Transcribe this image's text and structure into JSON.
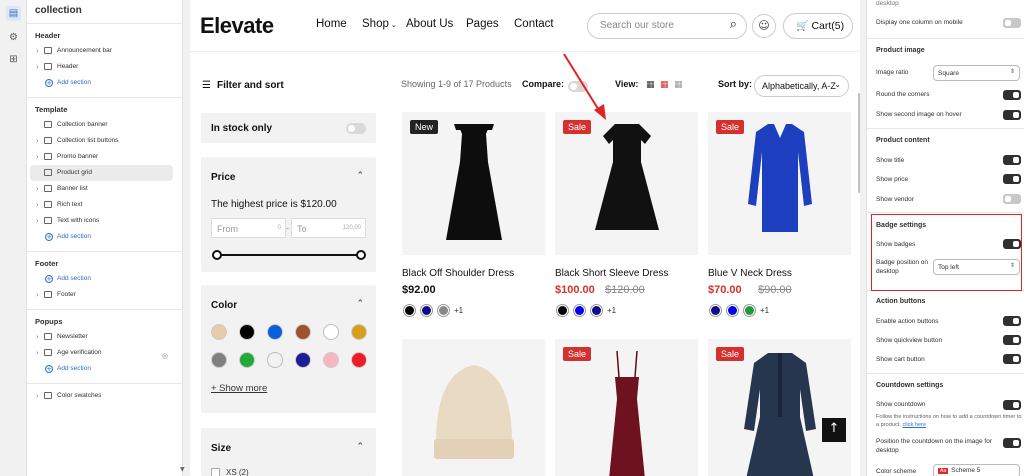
{
  "sidebar": {
    "title": "collection",
    "header_group": "Header",
    "announcement": "Announcement bar",
    "header": "Header",
    "add_section": "Add section",
    "template_group": "Template",
    "template_items": [
      "Collection banner",
      "Collection list buttons",
      "Promo banner",
      "Product grid",
      "Banner list",
      "Rich text",
      "Text with icons"
    ],
    "footer_group": "Footer",
    "footer": "Footer",
    "popups_group": "Popups",
    "newsletter": "Newsletter",
    "age": "Age verification",
    "color_swatches": "Color swatches"
  },
  "store": {
    "logo": "Elevate",
    "nav": [
      "Home",
      "Shop",
      "About Us",
      "Pages",
      "Contact"
    ],
    "search_placeholder": "Search our store",
    "cart": "Cart(5)"
  },
  "filters": {
    "title": "Filter and sort",
    "in_stock": "In stock only",
    "price_title": "Price",
    "price_text": "The highest price is $120.00",
    "from_label": "From",
    "from_val": "0",
    "to_label": "To",
    "to_val": "120.00",
    "currency_sep": "-",
    "color_title": "Color",
    "show_more": "+ Show more",
    "size_title": "Size",
    "size_first": "XS (2)",
    "colors": [
      "#e6ccaa",
      "#000000",
      "#0a60d8",
      "#a0522d",
      "#ffffff",
      "#d4a017",
      "#808080",
      "#1faa3a",
      "#f2f2f2",
      "#1e1e96",
      "#f7b6c2",
      "#ee1c24"
    ]
  },
  "toolbar": {
    "showing": "Showing 1-9 of 17 Products",
    "compare": "Compare:",
    "view": "View:",
    "sort_label": "Sort by:",
    "sort_value": "Alphabetically, A-Z"
  },
  "products": [
    {
      "name": "Black Off Shoulder Dress",
      "price": "$92.00",
      "compare": "",
      "badge": "New",
      "swatches": [
        "#000000",
        "#0b0b8c",
        "#888888"
      ],
      "more": "+1"
    },
    {
      "name": "Black Short Sleeve Dress",
      "price": "$100.00",
      "compare": "$120.00",
      "badge": "Sale",
      "swatches": [
        "#000000",
        "#0000ee",
        "#0b0b8c"
      ],
      "more": "+1"
    },
    {
      "name": "Blue V Neck Dress",
      "price": "$70.00",
      "compare": "$90.00",
      "badge": "Sale",
      "swatches": [
        "#0b0b8c",
        "#0000ee",
        "#1e9a3a"
      ],
      "more": "+1"
    },
    {
      "name": "",
      "price": "",
      "compare": "",
      "badge": "",
      "swatches": [],
      "more": ""
    },
    {
      "name": "",
      "price": "",
      "compare": "",
      "badge": "Sale",
      "swatches": [],
      "more": ""
    },
    {
      "name": "",
      "price": "",
      "compare": "",
      "badge": "Sale",
      "swatches": [],
      "more": ""
    }
  ],
  "settings": {
    "top_cut": "desktop",
    "one_col": "Display one column on mobile",
    "product_image": "Product image",
    "image_ratio": "Image ratio",
    "image_ratio_val": "Square",
    "round": "Round the corners",
    "second": "Show second image on hover",
    "product_content": "Product content",
    "show_title": "Show title",
    "show_price": "Show price",
    "show_vendor": "Show vendor",
    "badge_settings": "Badge settings",
    "show_badges": "Show badges",
    "badge_position": "Badge position on desktop",
    "badge_position_val": "Top left",
    "action_buttons": "Action buttons",
    "enable_action": "Enable action buttons",
    "quickview": "Show quickview button",
    "cart_btn": "Show cart button",
    "countdown": "Countdown settings",
    "show_countdown": "Show countdown",
    "countdown_help": "Follow the instructions on how to add a countdown timer to a product,",
    "click_here": "click here",
    "countdown_pos": "Position the countdown on the image for desktop",
    "color_scheme": "Color scheme",
    "scheme_val": "Scheme 5"
  },
  "colors": {
    "accent": "#2c6ecb",
    "sale": "#d4302f",
    "highlight": "#e02424"
  }
}
